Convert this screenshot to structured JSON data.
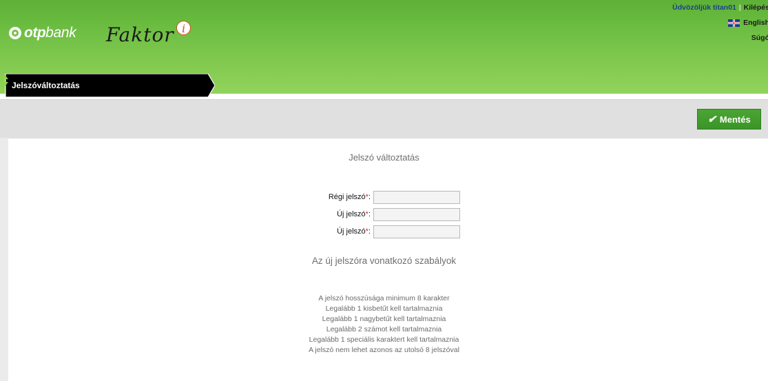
{
  "header": {
    "logo_brand": "otp",
    "logo_suffix": "bank",
    "app_name": "Faktor",
    "app_badge": "i",
    "welcome_text": "Üdvözöljük titan01",
    "logout_label": "Kilépés",
    "language_label": "English",
    "language_icon": "uk-flag-icon",
    "help_label": "Súgó"
  },
  "function_selector": {
    "label": "Jelszóváltoztatás",
    "arrow_icon": "up-down-arrows-icon"
  },
  "toolbar": {
    "save_label": "Mentés",
    "save_icon": "checkmark-icon"
  },
  "form": {
    "title": "Jelszó változtatás",
    "fields": [
      {
        "label": "Régi jelszó",
        "required_mark": "*",
        "suffix": ":",
        "value": ""
      },
      {
        "label": "Új jelszó",
        "required_mark": "*",
        "suffix": ":",
        "value": ""
      },
      {
        "label": "Új jelszó",
        "required_mark": "*",
        "suffix": ":",
        "value": ""
      }
    ]
  },
  "rules": {
    "title": "Az új jelszóra vonatkozó szabályok",
    "items": [
      "A jelszó hosszúsága minimum 8 karakter",
      "Legalább 1 kisbetűt kell tartalmaznia",
      "Legalább 1 nagybetűt kell tartalmaznia",
      "Legalább 2 számot kell tartalmaznia",
      "Legalább 1 speciális karaktert kell tartalmaznia",
      "A jelszó nem lehet azonos az utolsó 8 jelszóval"
    ]
  },
  "colors": {
    "header_green": "#72c146",
    "save_green": "#3b9427",
    "toolbar_gray": "#e0e0e0",
    "required_red": "#d62424"
  }
}
